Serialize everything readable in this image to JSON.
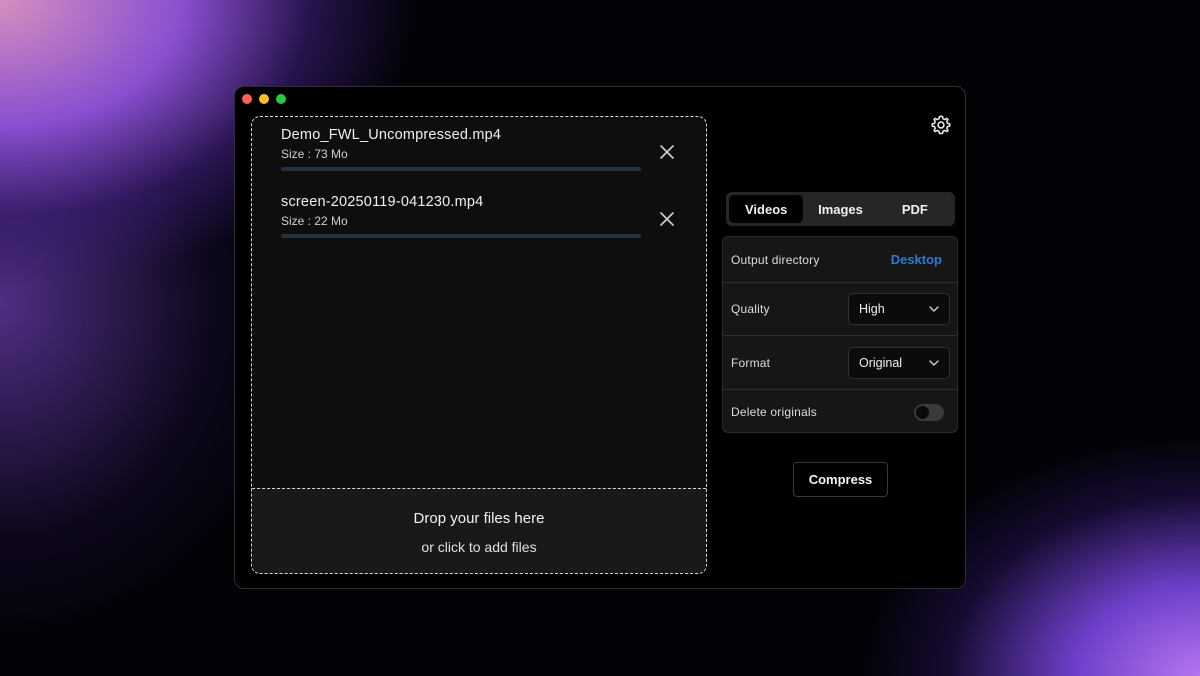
{
  "files": [
    {
      "name": "Demo_FWL_Uncompressed.mp4",
      "size": "Size : 73 Mo"
    },
    {
      "name": "screen-20250119-041230.mp4",
      "size": "Size : 22 Mo"
    }
  ],
  "dropzone": {
    "title": "Drop your files here",
    "subtitle": "or click to add files"
  },
  "tabs": [
    {
      "label": "Videos",
      "active": true
    },
    {
      "label": "Images",
      "active": false
    },
    {
      "label": "PDF",
      "active": false
    }
  ],
  "settings": {
    "output_directory": {
      "label": "Output directory",
      "value": "Desktop"
    },
    "quality": {
      "label": "Quality",
      "value": "High"
    },
    "format": {
      "label": "Format",
      "value": "Original"
    },
    "delete_originals": {
      "label": "Delete originals",
      "enabled": false
    }
  },
  "compress_label": "Compress",
  "colors": {
    "accent_link": "#2d7ad6",
    "progress_track": "#23313f",
    "traffic_red": "#fe5f57",
    "traffic_yellow": "#febc2e",
    "traffic_green": "#28c840"
  },
  "icons": {
    "remove": "close-icon",
    "settings": "gear-icon",
    "dropdown": "chevron-down-icon"
  }
}
